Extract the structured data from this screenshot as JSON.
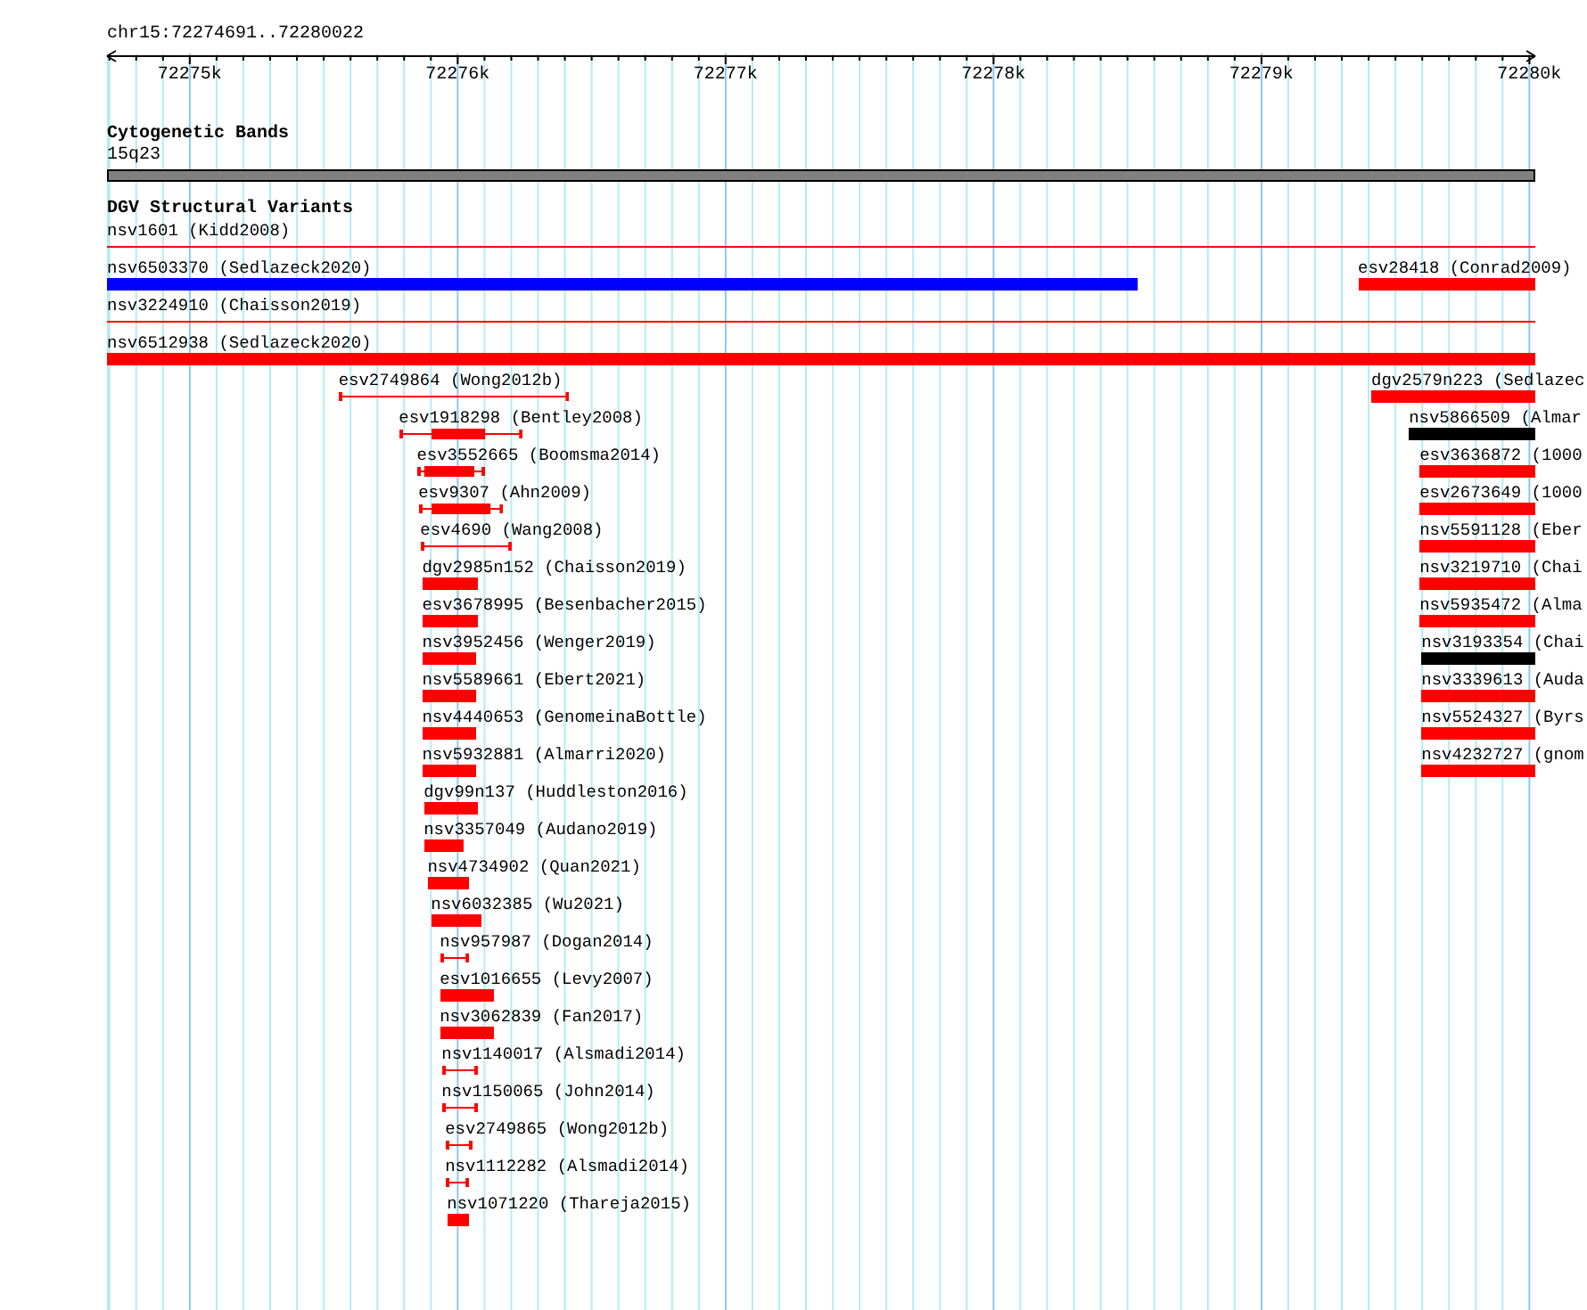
{
  "ruler": {
    "label": "chr15:72274691..72280022",
    "ticks": [
      "72275k",
      "72276k",
      "72277k",
      "72278k",
      "72279k",
      "72280k"
    ]
  },
  "cytogenetic_track": {
    "title": "Cytogenetic Bands",
    "bands": [
      {
        "label": "15q23",
        "color": "#808080"
      }
    ]
  },
  "dgv_track": {
    "title": "DGV Structural Variants",
    "rows": [
      [
        {
          "label": "nsv1601 (Kidd2008)",
          "kind": "line",
          "color": "#ff0000"
        }
      ],
      [
        {
          "label": "nsv6503370 (Sedlazeck2020)",
          "kind": "bar",
          "color": "#0000ff"
        },
        {
          "label": "esv28418 (Conrad2009)",
          "kind": "bar",
          "color": "#ff0000"
        }
      ],
      [
        {
          "label": "nsv3224910 (Chaisson2019)",
          "kind": "line",
          "color": "#ff0000"
        }
      ],
      [
        {
          "label": "nsv6512938 (Sedlazeck2020)",
          "kind": "bar",
          "color": "#ff0000"
        }
      ],
      [
        {
          "label": "esv2749864 (Wong2012b)",
          "kind": "whisker",
          "color": "#ff0000"
        },
        {
          "label": "dgv2579n223 (Sedlazec",
          "kind": "bar",
          "color": "#ff0000"
        }
      ],
      [
        {
          "label": "esv1918298 (Bentley2008)",
          "kind": "whisker",
          "color": "#ff0000"
        },
        {
          "label": "nsv5866509 (Almar",
          "kind": "bar",
          "color": "#000000"
        }
      ],
      [
        {
          "label": "esv3552665 (Boomsma2014)",
          "kind": "whisker",
          "color": "#ff0000"
        },
        {
          "label": "esv3636872 (1000",
          "kind": "bar",
          "color": "#ff0000"
        }
      ],
      [
        {
          "label": "esv9307 (Ahn2009)",
          "kind": "whisker",
          "color": "#ff0000"
        },
        {
          "label": "esv2673649 (1000",
          "kind": "bar",
          "color": "#ff0000"
        }
      ],
      [
        {
          "label": "esv4690 (Wang2008)",
          "kind": "whisker",
          "color": "#ff0000"
        },
        {
          "label": "nsv5591128 (Eber",
          "kind": "bar",
          "color": "#ff0000"
        }
      ],
      [
        {
          "label": "dgv2985n152 (Chaisson2019)",
          "kind": "bar",
          "color": "#ff0000"
        },
        {
          "label": "nsv3219710 (Chai",
          "kind": "bar",
          "color": "#ff0000"
        }
      ],
      [
        {
          "label": "esv3678995 (Besenbacher2015)",
          "kind": "bar",
          "color": "#ff0000"
        },
        {
          "label": "nsv5935472 (Alma",
          "kind": "bar",
          "color": "#ff0000"
        }
      ],
      [
        {
          "label": "nsv3952456 (Wenger2019)",
          "kind": "bar",
          "color": "#ff0000"
        },
        {
          "label": "nsv3193354 (Chai",
          "kind": "bar",
          "color": "#000000"
        }
      ],
      [
        {
          "label": "nsv5589661 (Ebert2021)",
          "kind": "bar",
          "color": "#ff0000"
        },
        {
          "label": "nsv3339613 (Auda",
          "kind": "bar",
          "color": "#ff0000"
        }
      ],
      [
        {
          "label": "nsv4440653 (GenomeinaBottle)",
          "kind": "bar",
          "color": "#ff0000"
        },
        {
          "label": "nsv5524327 (Byrs",
          "kind": "bar",
          "color": "#ff0000"
        }
      ],
      [
        {
          "label": "nsv5932881 (Almarri2020)",
          "kind": "bar",
          "color": "#ff0000"
        },
        {
          "label": "nsv4232727 (gnom",
          "kind": "bar",
          "color": "#ff0000"
        }
      ],
      [
        {
          "label": "dgv99n137 (Huddleston2016)",
          "kind": "bar",
          "color": "#ff0000"
        }
      ],
      [
        {
          "label": "nsv3357049 (Audano2019)",
          "kind": "bar",
          "color": "#ff0000"
        }
      ],
      [
        {
          "label": "nsv4734902 (Quan2021)",
          "kind": "bar",
          "color": "#ff0000"
        }
      ],
      [
        {
          "label": "nsv6032385 (Wu2021)",
          "kind": "bar",
          "color": "#ff0000"
        }
      ],
      [
        {
          "label": "nsv957987 (Dogan2014)",
          "kind": "whisker",
          "color": "#ff0000"
        }
      ],
      [
        {
          "label": "esv1016655 (Levy2007)",
          "kind": "bar",
          "color": "#ff0000"
        }
      ],
      [
        {
          "label": "nsv3062839 (Fan2017)",
          "kind": "bar",
          "color": "#ff0000"
        }
      ],
      [
        {
          "label": "nsv1140017 (Alsmadi2014)",
          "kind": "whisker",
          "color": "#ff0000"
        }
      ],
      [
        {
          "label": "nsv1150065 (John2014)",
          "kind": "whisker",
          "color": "#ff0000"
        }
      ],
      [
        {
          "label": "esv2749865 (Wong2012b)",
          "kind": "whisker",
          "color": "#ff0000"
        }
      ],
      [
        {
          "label": "nsv1112282 (Alsmadi2014)",
          "kind": "whisker",
          "color": "#ff0000"
        }
      ],
      [
        {
          "label": "nsv1071220 (Thareja2015)",
          "kind": "bar",
          "color": "#ff0000"
        }
      ]
    ]
  }
}
